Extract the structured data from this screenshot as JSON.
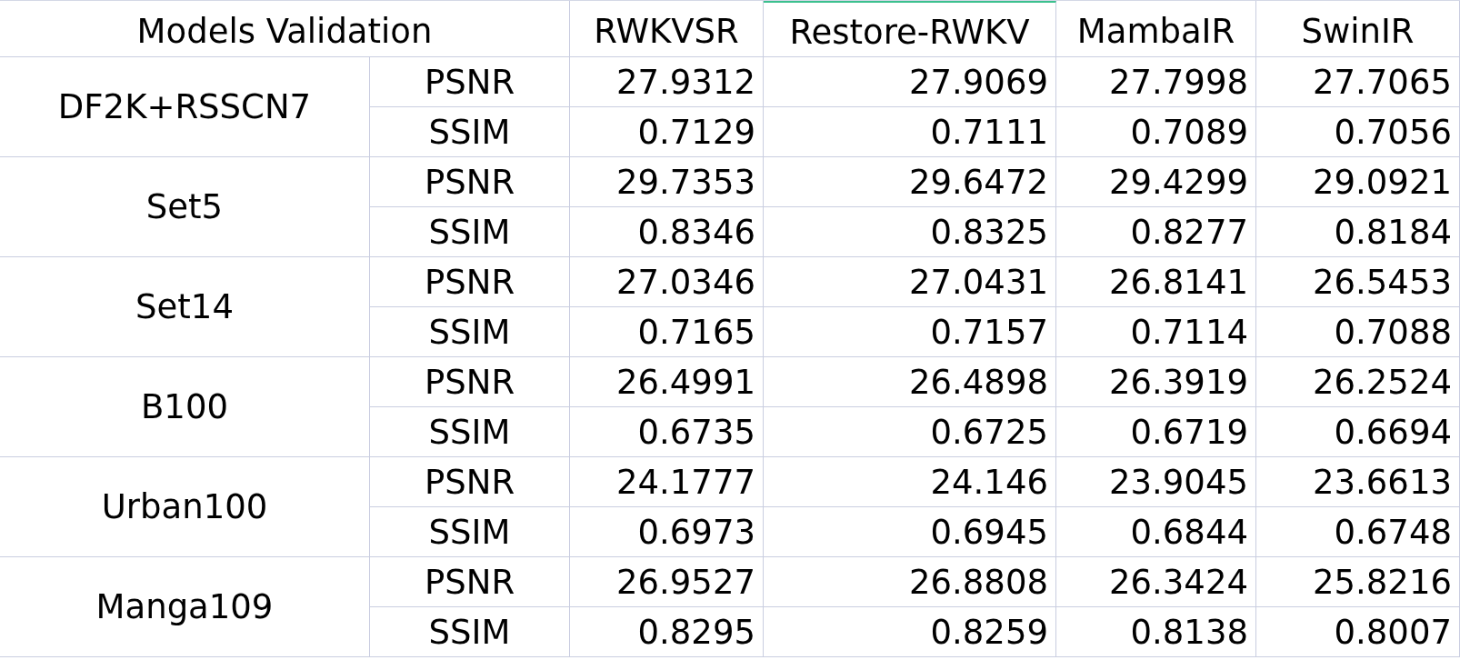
{
  "table": {
    "corner": "Models Validation",
    "columns": [
      {
        "label": "RWKVSR",
        "selected": false
      },
      {
        "label": "Restore-RWKV",
        "selected": true
      },
      {
        "label": "MambaIR",
        "selected": false
      },
      {
        "label": "SwinIR",
        "selected": false
      }
    ],
    "groups": [
      {
        "dataset": "DF2K+RSSCN7",
        "rows": [
          {
            "metric": "PSNR",
            "values": [
              "27.9312",
              "27.9069",
              "27.7998",
              "27.7065"
            ]
          },
          {
            "metric": "SSIM",
            "values": [
              "0.7129",
              "0.7111",
              "0.7089",
              "0.7056"
            ]
          }
        ]
      },
      {
        "dataset": "Set5",
        "rows": [
          {
            "metric": "PSNR",
            "values": [
              "29.7353",
              "29.6472",
              "29.4299",
              "29.0921"
            ]
          },
          {
            "metric": "SSIM",
            "values": [
              "0.8346",
              "0.8325",
              "0.8277",
              "0.8184"
            ]
          }
        ]
      },
      {
        "dataset": "Set14",
        "rows": [
          {
            "metric": "PSNR",
            "values": [
              "27.0346",
              "27.0431",
              "26.8141",
              "26.5453"
            ]
          },
          {
            "metric": "SSIM",
            "values": [
              "0.7165",
              "0.7157",
              "0.7114",
              "0.7088"
            ]
          }
        ]
      },
      {
        "dataset": "B100",
        "rows": [
          {
            "metric": "PSNR",
            "values": [
              "26.4991",
              "26.4898",
              "26.3919",
              "26.2524"
            ]
          },
          {
            "metric": "SSIM",
            "values": [
              "0.6735",
              "0.6725",
              "0.6719",
              "0.6694"
            ]
          }
        ]
      },
      {
        "dataset": "Urban100",
        "rows": [
          {
            "metric": "PSNR",
            "values": [
              "24.1777",
              "24.146",
              "23.9045",
              "23.6613"
            ]
          },
          {
            "metric": "SSIM",
            "values": [
              "0.6973",
              "0.6945",
              "0.6844",
              "0.6748"
            ]
          }
        ]
      },
      {
        "dataset": "Manga109",
        "rows": [
          {
            "metric": "PSNR",
            "values": [
              "26.9527",
              "26.8808",
              "26.3424",
              "25.8216"
            ]
          },
          {
            "metric": "SSIM",
            "values": [
              "0.8295",
              "0.8259",
              "0.8138",
              "0.8007"
            ]
          }
        ]
      }
    ]
  }
}
